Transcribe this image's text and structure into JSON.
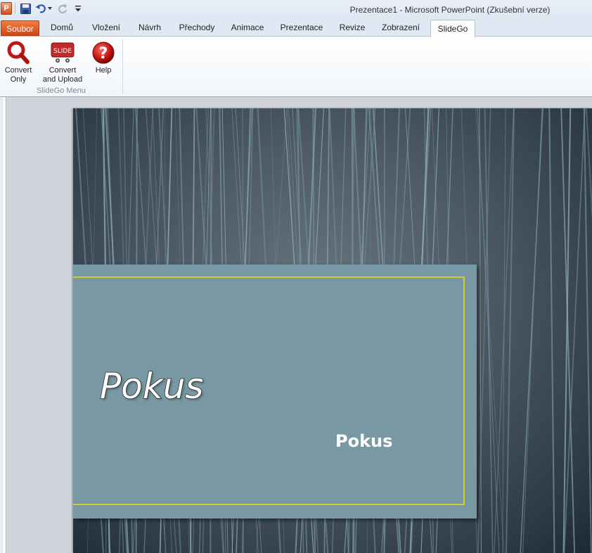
{
  "window": {
    "title": "Prezentace1  -  Microsoft PowerPoint (Zkušební verze)",
    "app_logo_letter": "P"
  },
  "quick_access": {
    "icons": [
      "powerpoint-logo-icon",
      "save-icon",
      "undo-icon",
      "undo-dropdown-icon",
      "redo-icon",
      "customize-toolbar-icon"
    ]
  },
  "tabs": [
    {
      "label": "Soubor"
    },
    {
      "label": "Domů"
    },
    {
      "label": "Vložení"
    },
    {
      "label": "Návrh"
    },
    {
      "label": "Přechody"
    },
    {
      "label": "Animace"
    },
    {
      "label": "Prezentace"
    },
    {
      "label": "Revize"
    },
    {
      "label": "Zobrazení"
    },
    {
      "label": "SlideGo"
    }
  ],
  "active_tab": "SlideGo",
  "ribbon": {
    "group_label": "SlideGo Menu",
    "buttons": [
      {
        "line1": "Convert",
        "line2": "Only",
        "icon": "magnifier-icon"
      },
      {
        "line1": "Convert",
        "line2": "and Upload",
        "icon": "slide-cart-icon",
        "icon_text": "SLIDE"
      },
      {
        "line1": "Help",
        "line2": "",
        "icon": "help-icon",
        "icon_text": "?"
      }
    ]
  },
  "slide": {
    "title": "Pokus",
    "subtitle": "Pokus"
  },
  "colors": {
    "file_tab": "#d24515",
    "title_box": "#7899a3",
    "frame_accent": "#d7c932",
    "background_dark": "#2c3944"
  }
}
